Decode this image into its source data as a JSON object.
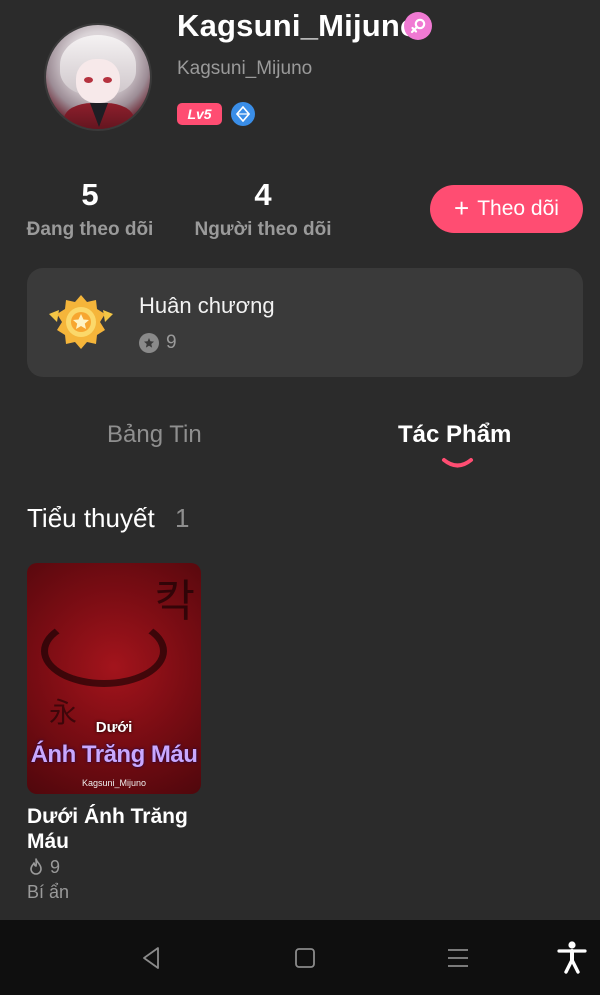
{
  "profile": {
    "display_name": "Kagsuni_Mijuno",
    "handle": "Kagsuni_Mijuno",
    "gender_icon": "female-symbol-icon",
    "level": "Lv5",
    "badge_icon": "gem-icon"
  },
  "stats": {
    "following_count": "5",
    "following_label": "Đang theo dõi",
    "followers_count": "4",
    "followers_label": "Người theo dõi"
  },
  "follow_button": {
    "icon": "+",
    "label": "Theo dõi"
  },
  "medals": {
    "title": "Huân chương",
    "count": "9"
  },
  "tabs": [
    {
      "label": "Bảng Tin",
      "active": false
    },
    {
      "label": "Tác Phẩm",
      "active": true
    }
  ],
  "section": {
    "title": "Tiểu thuyết",
    "count": "1"
  },
  "books": [
    {
      "title": "Dưới Ánh Trăng Máu",
      "cover_line1": "Dưới",
      "cover_line2": "Ánh Trăng Máu",
      "cover_author": "Kagsuni_Mijuno",
      "views": "9",
      "genre": "Bí ẩn"
    }
  ],
  "colors": {
    "background": "#2b2b2b",
    "card": "#3a3a3a",
    "accent": "#ff4d72",
    "muted_text": "#9a9a9a",
    "nav_bar": "#0f0f0f"
  },
  "navbar": {
    "icons": [
      "back-icon",
      "home-icon",
      "menu-icon",
      "accessibility-icon"
    ]
  }
}
